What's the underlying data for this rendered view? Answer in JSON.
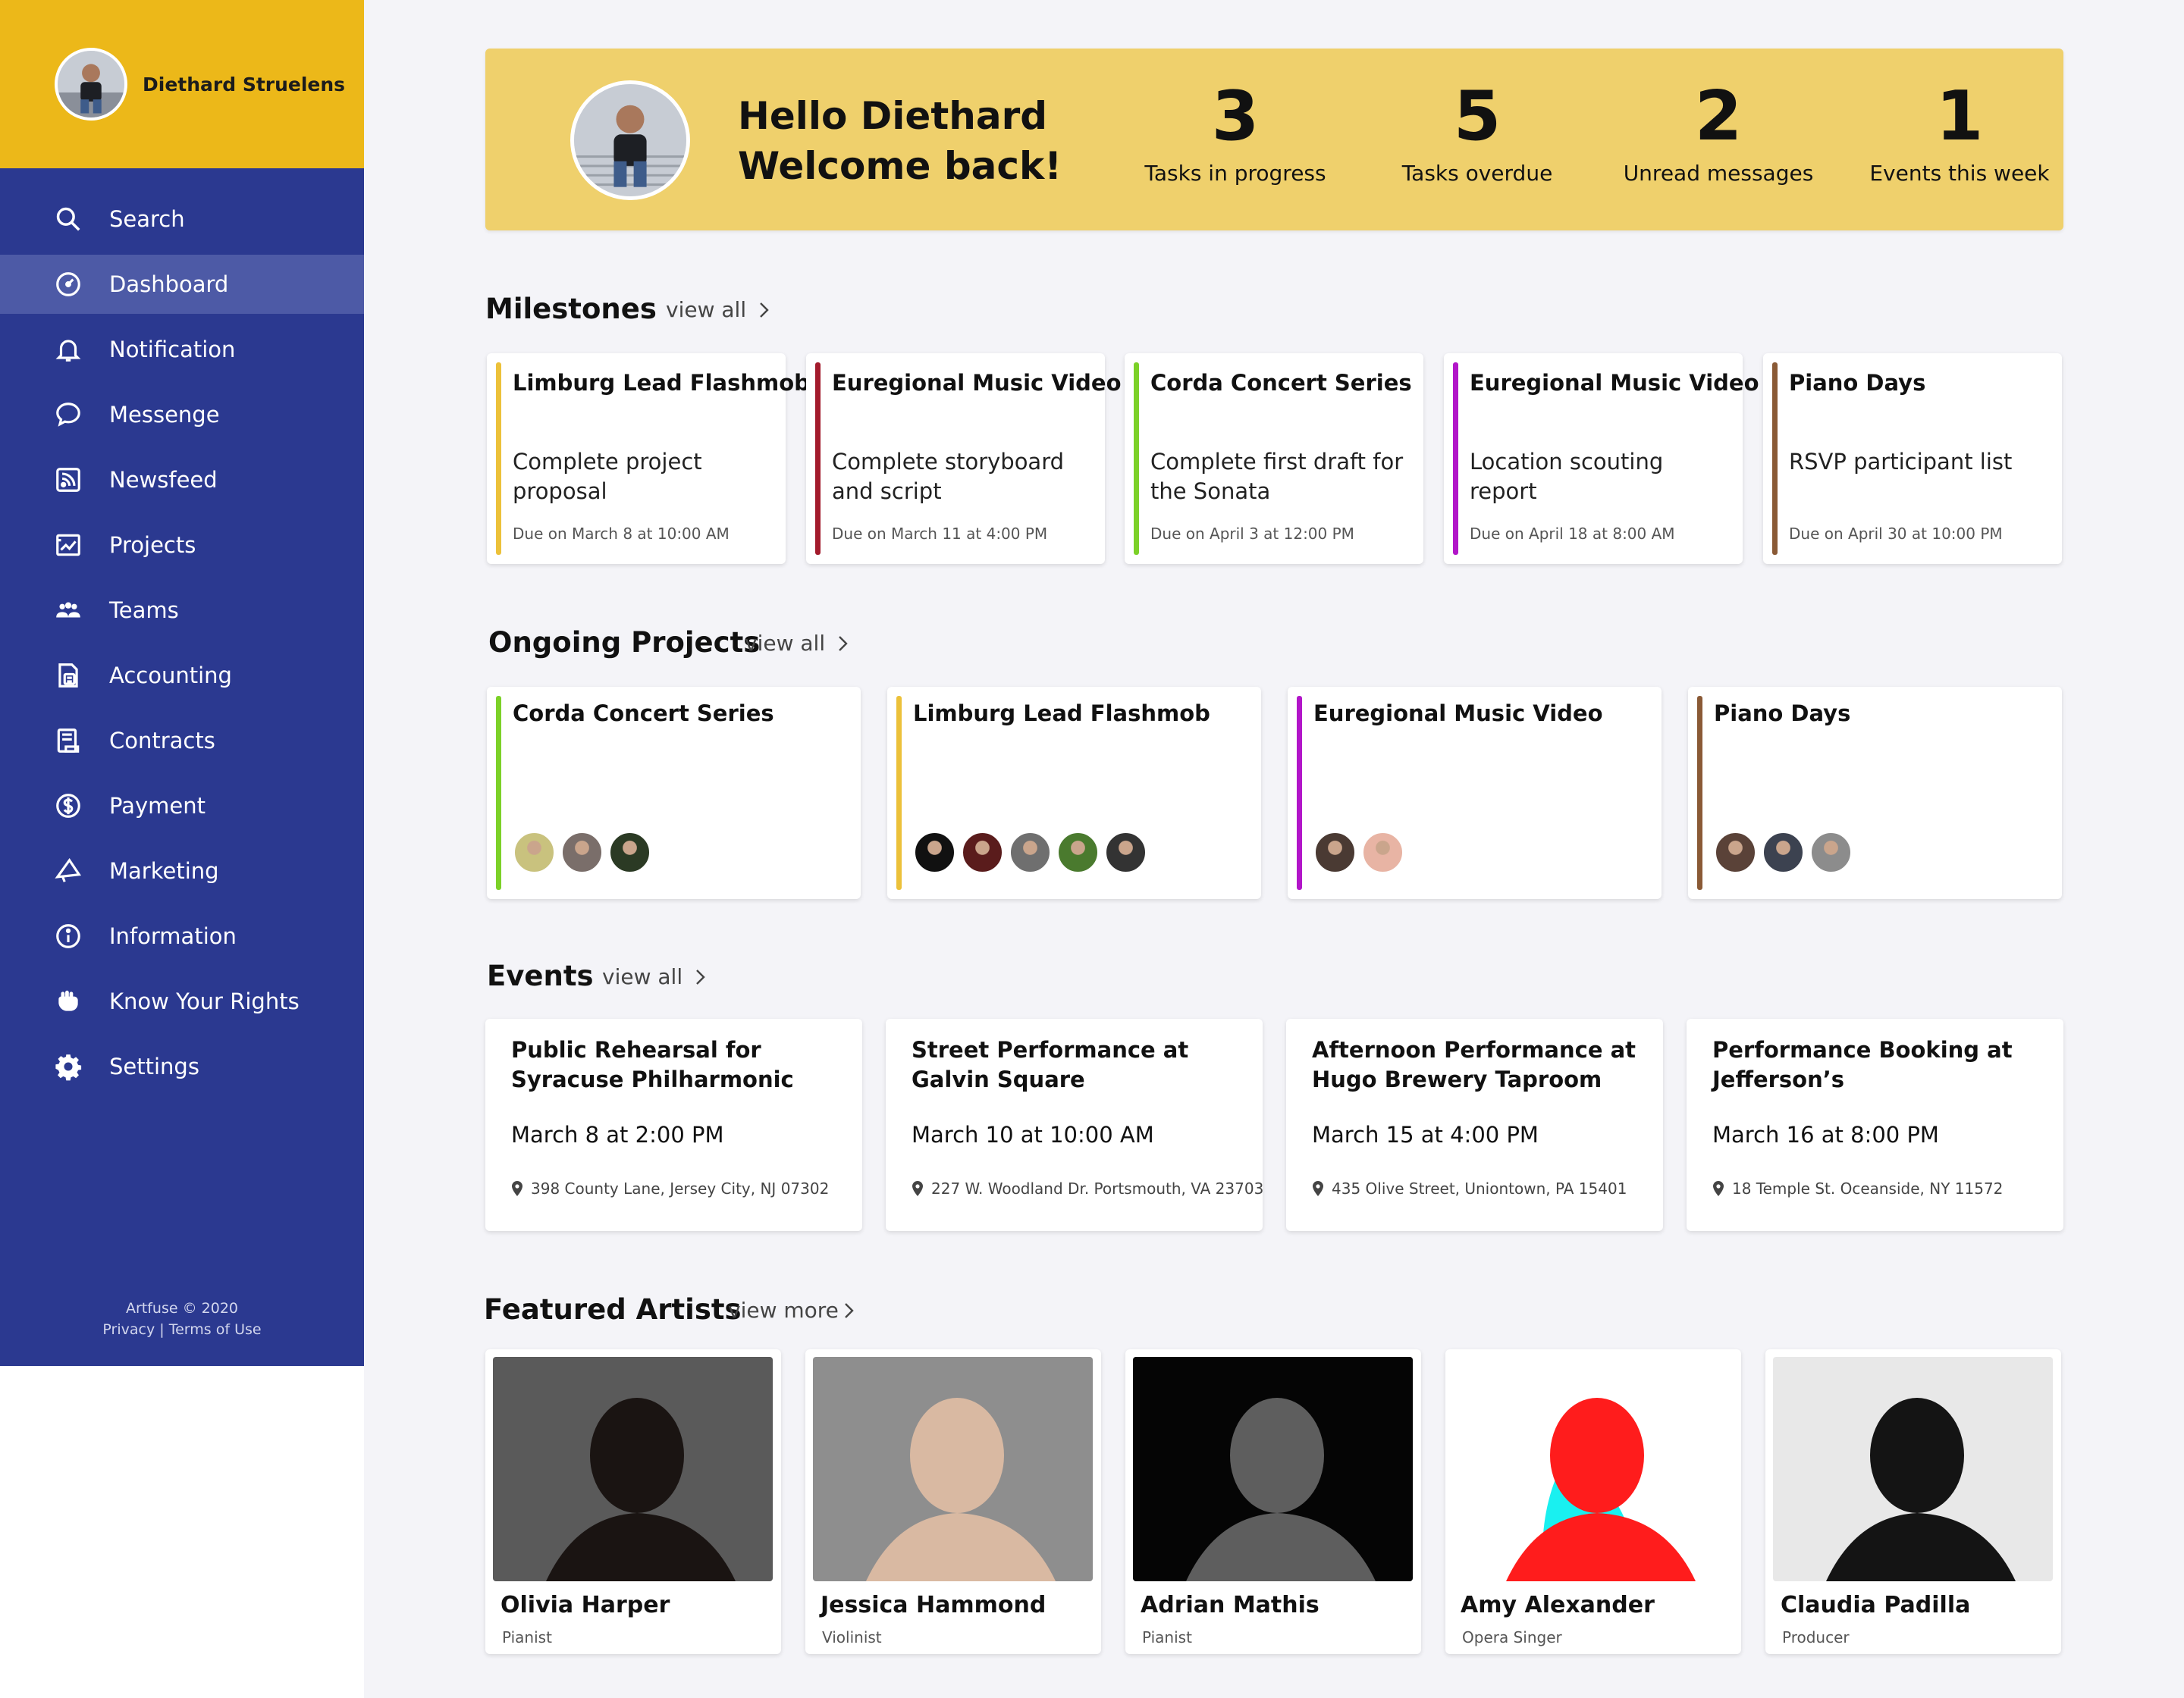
{
  "user": {
    "name": "Diethard Struelens"
  },
  "nav": {
    "items": [
      {
        "label": "Search",
        "icon": "search-icon"
      },
      {
        "label": "Dashboard",
        "icon": "dashboard-icon",
        "active": true
      },
      {
        "label": "Notification",
        "icon": "bell-icon"
      },
      {
        "label": "Messenge",
        "icon": "chat-bubble-icon"
      },
      {
        "label": "Newsfeed",
        "icon": "rss-icon"
      },
      {
        "label": "Projects",
        "icon": "projects-chart-icon"
      },
      {
        "label": "Teams",
        "icon": "team-icon"
      },
      {
        "label": "Accounting",
        "icon": "calculator-icon"
      },
      {
        "label": "Contracts",
        "icon": "contract-icon"
      },
      {
        "label": "Payment",
        "icon": "dollar-icon"
      },
      {
        "label": "Marketing",
        "icon": "megaphone-icon"
      },
      {
        "label": "Information",
        "icon": "info-icon"
      },
      {
        "label": "Know Your Rights",
        "icon": "fist-icon"
      },
      {
        "label": "Settings",
        "icon": "gear-icon"
      }
    ]
  },
  "footer": {
    "copyright": "Artfuse © 2020",
    "privacy": "Privacy",
    "separator": "|",
    "terms": "Terms of Use"
  },
  "welcome": {
    "line1": "Hello Diethard",
    "line2": "Welcome back!",
    "stats": [
      {
        "value": "3",
        "label": "Tasks in progress"
      },
      {
        "value": "5",
        "label": "Tasks overdue"
      },
      {
        "value": "2",
        "label": "Unread messages"
      },
      {
        "value": "1",
        "label": "Events this week"
      }
    ]
  },
  "milestones": {
    "title": "Milestones",
    "view_all": "view all",
    "items": [
      {
        "project": "Limburg Lead Flashmob",
        "task": "Complete project proposal",
        "due": "Due on March 8 at 10:00 AM",
        "color": "#ecc13a"
      },
      {
        "project": "Euregional Music Video",
        "task": "Complete storyboard and script",
        "due": "Due on March 11 at 4:00 PM",
        "color": "#a31b2c"
      },
      {
        "project": "Corda Concert Series",
        "task": "Complete first draft for the Sonata",
        "due": "Due on April 3 at 12:00 PM",
        "color": "#7cd128"
      },
      {
        "project": "Euregional Music Video",
        "task": "Location scouting report",
        "due": "Due on April 18 at 8:00 AM",
        "color": "#b216c9"
      },
      {
        "project": "Piano Days",
        "task": "RSVP participant list",
        "due": "Due on April 30 at 10:00 PM",
        "color": "#8a5a36"
      }
    ]
  },
  "projects": {
    "title": "Ongoing Projects",
    "view_all": "view all",
    "items": [
      {
        "name": "Corda Concert Series",
        "color": "#7cd128",
        "members": [
          "#c9c27e",
          "#7a6e6a",
          "#2b3a24"
        ]
      },
      {
        "name": "Limburg Lead Flashmob",
        "color": "#ecc13a",
        "members": [
          "#111111",
          "#5a1c1c",
          "#6f6f6f",
          "#4a7a2e",
          "#333333"
        ]
      },
      {
        "name": "Euregional Music Video",
        "color": "#b216c9",
        "members": [
          "#4a3a33",
          "#e8b4a4"
        ]
      },
      {
        "name": "Piano Days",
        "color": "#8a5a36",
        "members": [
          "#5a4238",
          "#3c4250",
          "#8c8c8c"
        ]
      }
    ]
  },
  "events": {
    "title": "Events",
    "view_all": "view all",
    "items": [
      {
        "title": "Public Rehearsal for Syracuse Philharmonic",
        "date": "March 8 at 2:00 PM",
        "location": "398 County Lane, Jersey City, NJ 07302"
      },
      {
        "title": "Street Performance at Galvin Square",
        "date": "March 10 at 10:00 AM",
        "location": "227 W. Woodland Dr. Portsmouth, VA 23703"
      },
      {
        "title": "Afternoon Performance at Hugo Brewery Taproom",
        "date": "March 15 at 4:00 PM",
        "location": "435 Olive Street, Uniontown, PA 15401"
      },
      {
        "title": "Performance Booking at Jefferson’s",
        "date": "March 16 at 8:00 PM",
        "location": "18 Temple St. Oceanside, NY 11572"
      }
    ]
  },
  "artists": {
    "title": "Featured Artists",
    "view_more": "view more",
    "items": [
      {
        "name": "Olivia Harper",
        "role": "Pianist",
        "bg": "#5a5a5a",
        "fg": "#1a1412"
      },
      {
        "name": "Jessica Hammond",
        "role": "Violinist",
        "bg": "#8e8e8e",
        "fg": "#d9b9a2"
      },
      {
        "name": "Adrian Mathis",
        "role": "Pianist",
        "bg": "#050505",
        "fg": "#5e5e5e"
      },
      {
        "name": "Amy Alexander",
        "role": "Opera Singer",
        "bg": "#ffffff",
        "fg": "#ff1c1c",
        "accent": "#19f0f0"
      },
      {
        "name": "Claudia Padilla",
        "role": "Producer",
        "bg": "#e8e8e8",
        "fg": "#141414"
      }
    ]
  }
}
